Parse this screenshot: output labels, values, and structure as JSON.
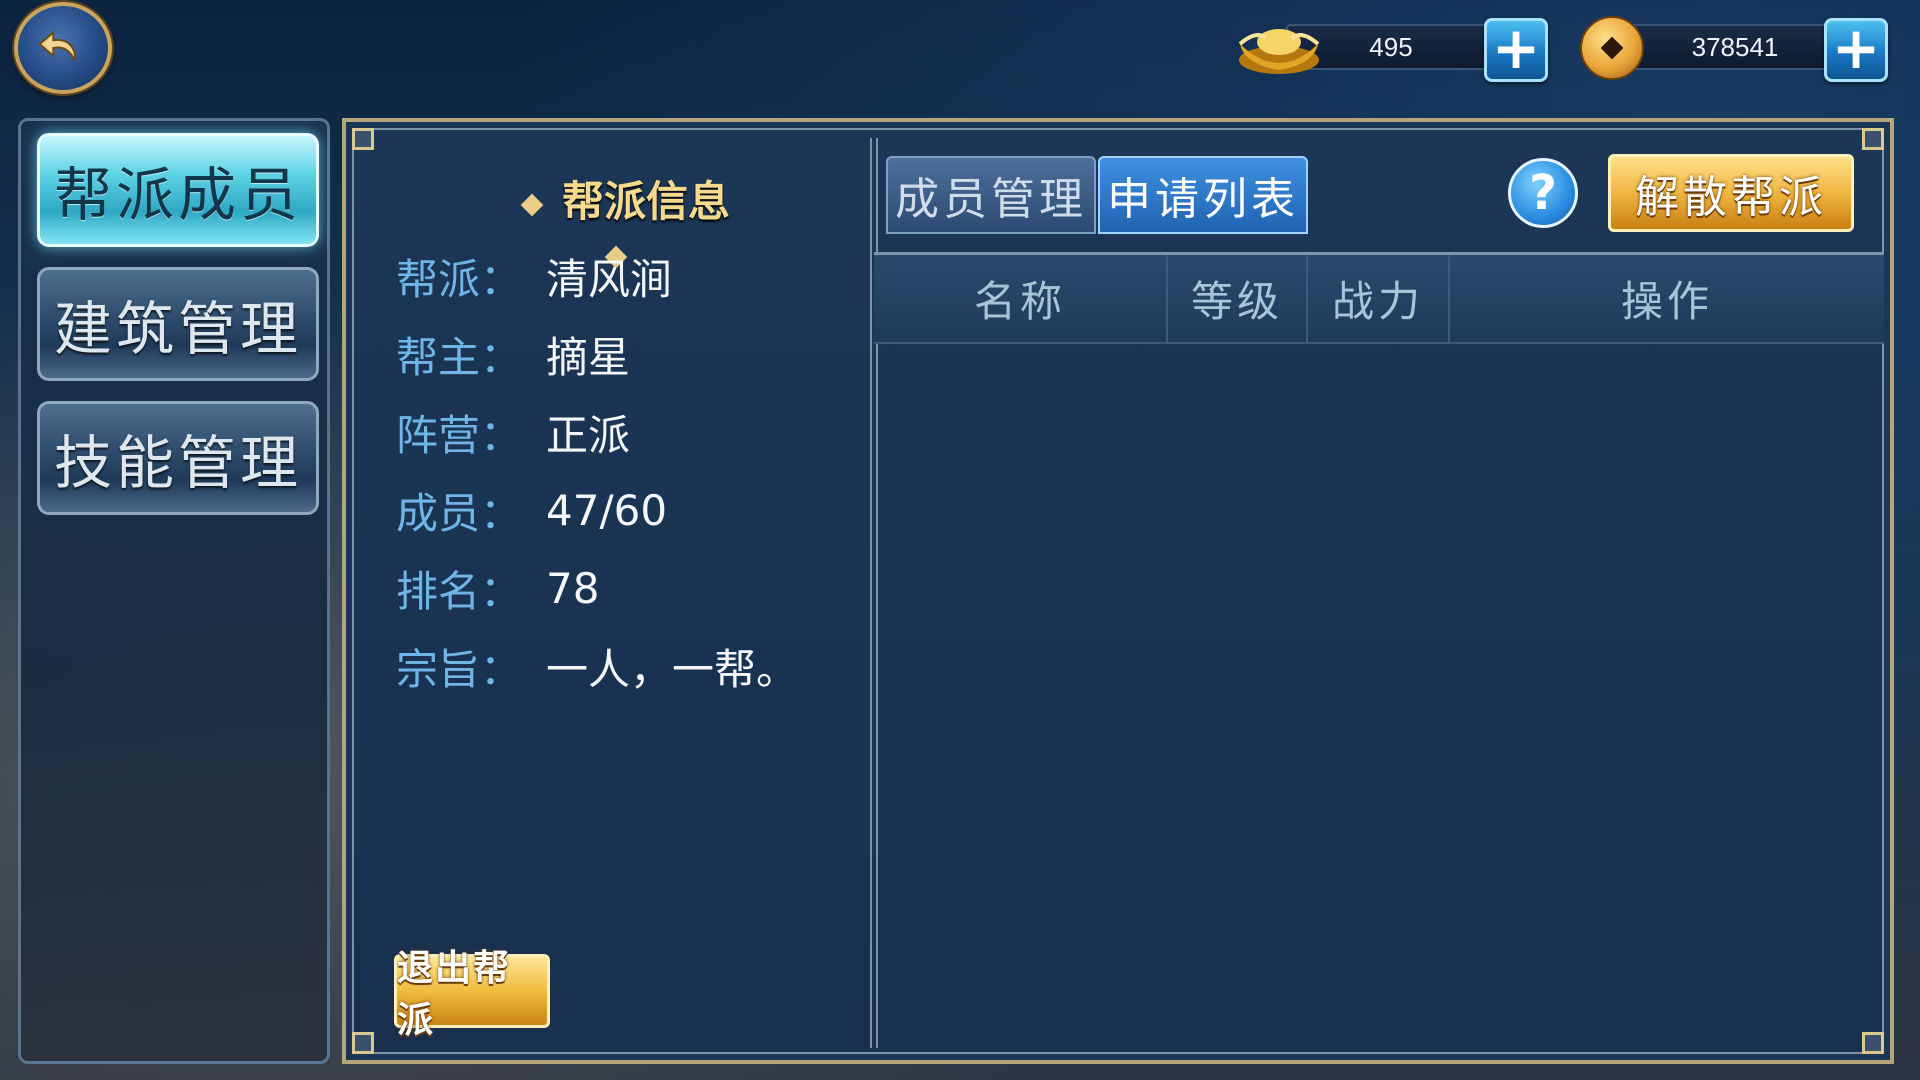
{
  "currency": {
    "ingot": "495",
    "coins": "378541"
  },
  "nav": {
    "items": [
      {
        "label": "帮派成员",
        "active": true
      },
      {
        "label": "建筑管理",
        "active": false
      },
      {
        "label": "技能管理",
        "active": false
      }
    ]
  },
  "info": {
    "title": "帮派信息",
    "rows": [
      {
        "label": "帮派：",
        "value": "清风涧"
      },
      {
        "label": "帮主：",
        "value": "摘星"
      },
      {
        "label": "阵营：",
        "value": "正派"
      },
      {
        "label": "成员：",
        "value": "47/60"
      },
      {
        "label": "排名：",
        "value": "78"
      },
      {
        "label": "宗旨：",
        "value": "一人，一帮。"
      }
    ],
    "quit_label": "退出帮派"
  },
  "members": {
    "tabs": [
      {
        "label": "成员管理",
        "active": false
      },
      {
        "label": "申请列表",
        "active": true
      }
    ],
    "help_label": "?",
    "disband_label": "解散帮派",
    "columns": [
      "名称",
      "等级",
      "战力",
      "操作"
    ]
  }
}
